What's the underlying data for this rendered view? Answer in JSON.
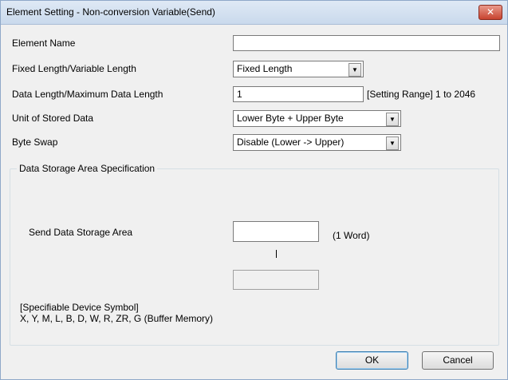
{
  "window": {
    "title": "Element Setting - Non-conversion Variable(Send)",
    "close_glyph": "✕"
  },
  "form": {
    "element_name": {
      "label": "Element Name",
      "value": ""
    },
    "length_mode": {
      "label": "Fixed Length/Variable Length",
      "value": "Fixed Length"
    },
    "data_length": {
      "label": "Data Length/Maximum Data Length",
      "value": "1",
      "hint": "[Setting Range] 1 to 2046"
    },
    "unit": {
      "label": "Unit of Stored Data",
      "value": "Lower Byte + Upper Byte"
    },
    "byte_swap": {
      "label": "Byte Swap",
      "value": "Disable (Lower -> Upper)"
    }
  },
  "storage": {
    "group_label": "Data Storage Area Specification",
    "send_label": "Send Data Storage Area",
    "send_value": "",
    "unit_note": "(1 Word)",
    "end_value": "",
    "device_title": "[Specifiable Device Symbol]",
    "device_list": "X, Y, M, L, B, D, W, R, ZR, G (Buffer Memory)"
  },
  "buttons": {
    "ok": "OK",
    "cancel": "Cancel"
  },
  "icons": {
    "combo_arrow": "▼"
  }
}
